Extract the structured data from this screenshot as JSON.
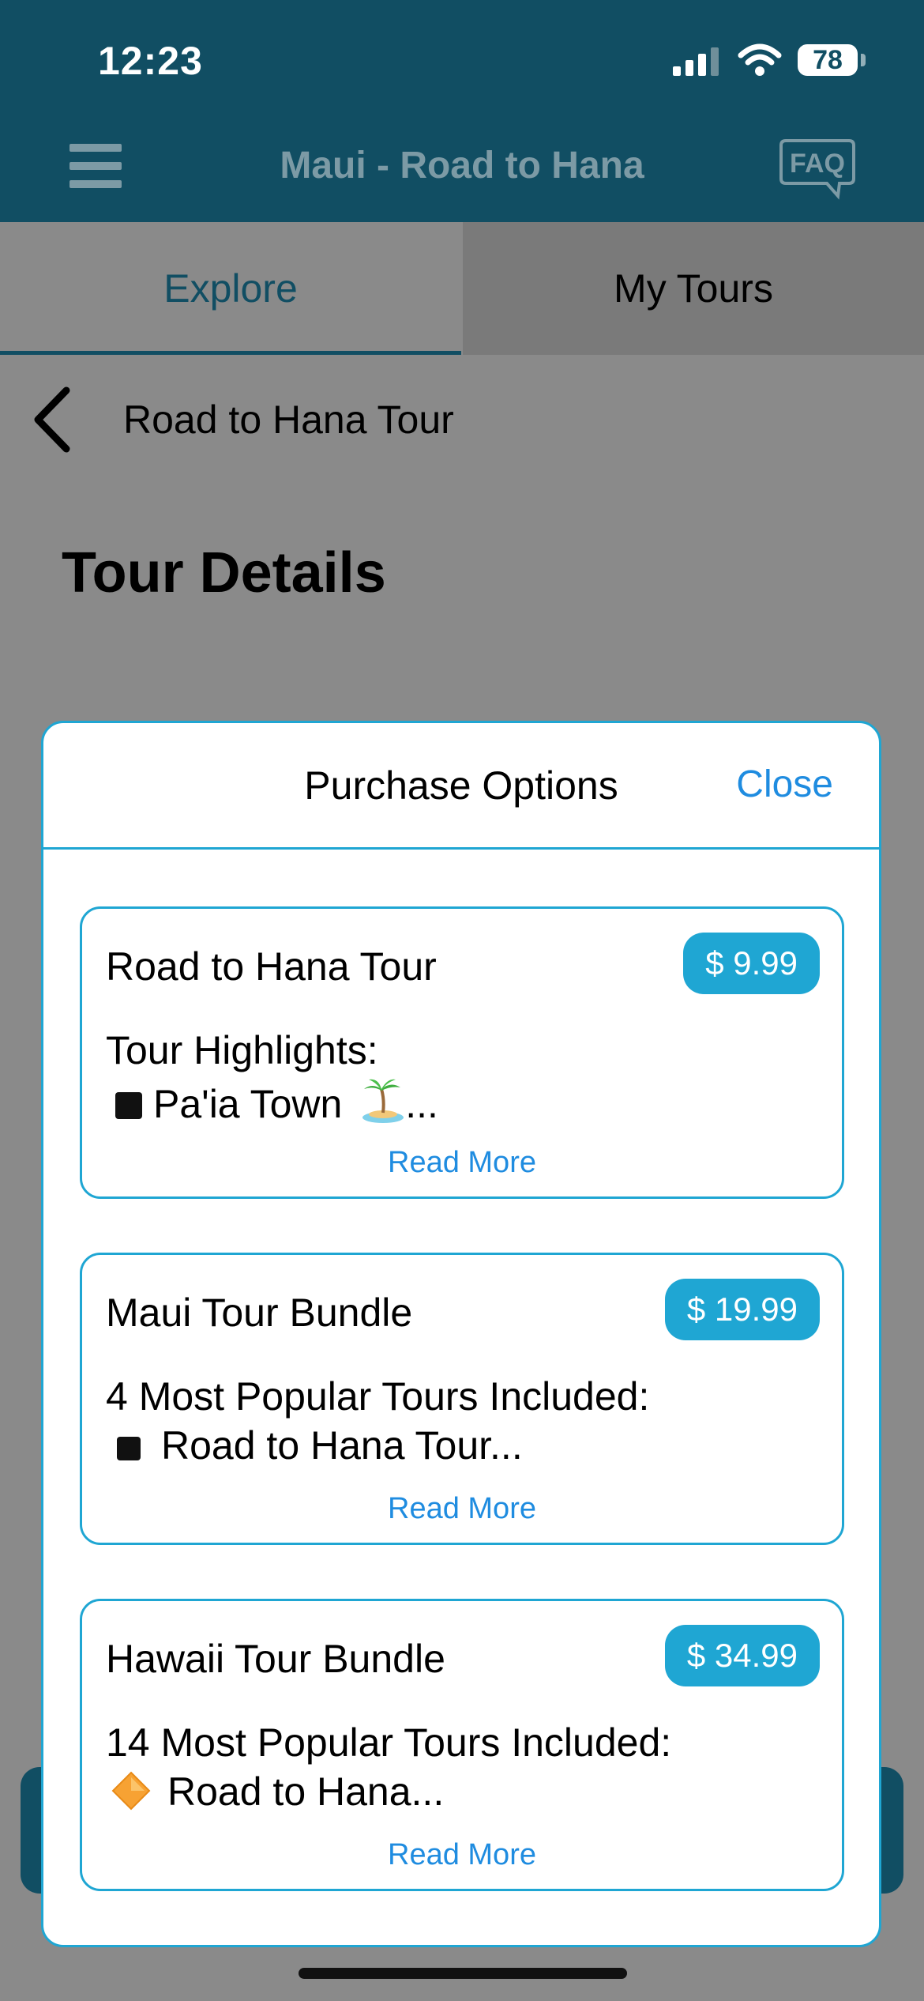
{
  "status_bar": {
    "time": "12:23",
    "battery": "78"
  },
  "app_bar": {
    "title": "Maui - Road to Hana",
    "faq_label": "FAQ"
  },
  "tabs": [
    {
      "label": "Explore",
      "selected": true
    },
    {
      "label": "My Tours",
      "selected": false
    }
  ],
  "page": {
    "back_title": "Road to Hana Tour",
    "heading": "Tour Details"
  },
  "modal": {
    "title": "Purchase Options",
    "close_label": "Close",
    "cards": [
      {
        "title": "Road to Hana Tour",
        "price": "$ 9.99",
        "line1": "Tour Highlights:",
        "line2_text": "Pa'ia Town",
        "line2_suffix": "...",
        "read_more": "Read More"
      },
      {
        "title": "Maui Tour Bundle",
        "price": "$ 19.99",
        "line1": "4 Most Popular Tours Included:",
        "line2_text": "Road to Hana Tour...",
        "read_more": "Read More"
      },
      {
        "title": "Hawaii Tour Bundle",
        "price": "$ 34.99",
        "line1": "14 Most Popular Tours Included:",
        "line2_text": "Road to Hana...",
        "read_more": "Read More"
      }
    ]
  },
  "colors": {
    "header": "#114e63",
    "accent": "#1fa6d3",
    "link": "#1f8ce0",
    "overlay": "#8a8a8a"
  },
  "icons": [
    "menu-icon",
    "faq-icon",
    "back-chevron-icon",
    "signal-icon",
    "wifi-icon",
    "battery-icon",
    "palm-island-icon",
    "black-square-icon",
    "orange-diamond-icon"
  ]
}
